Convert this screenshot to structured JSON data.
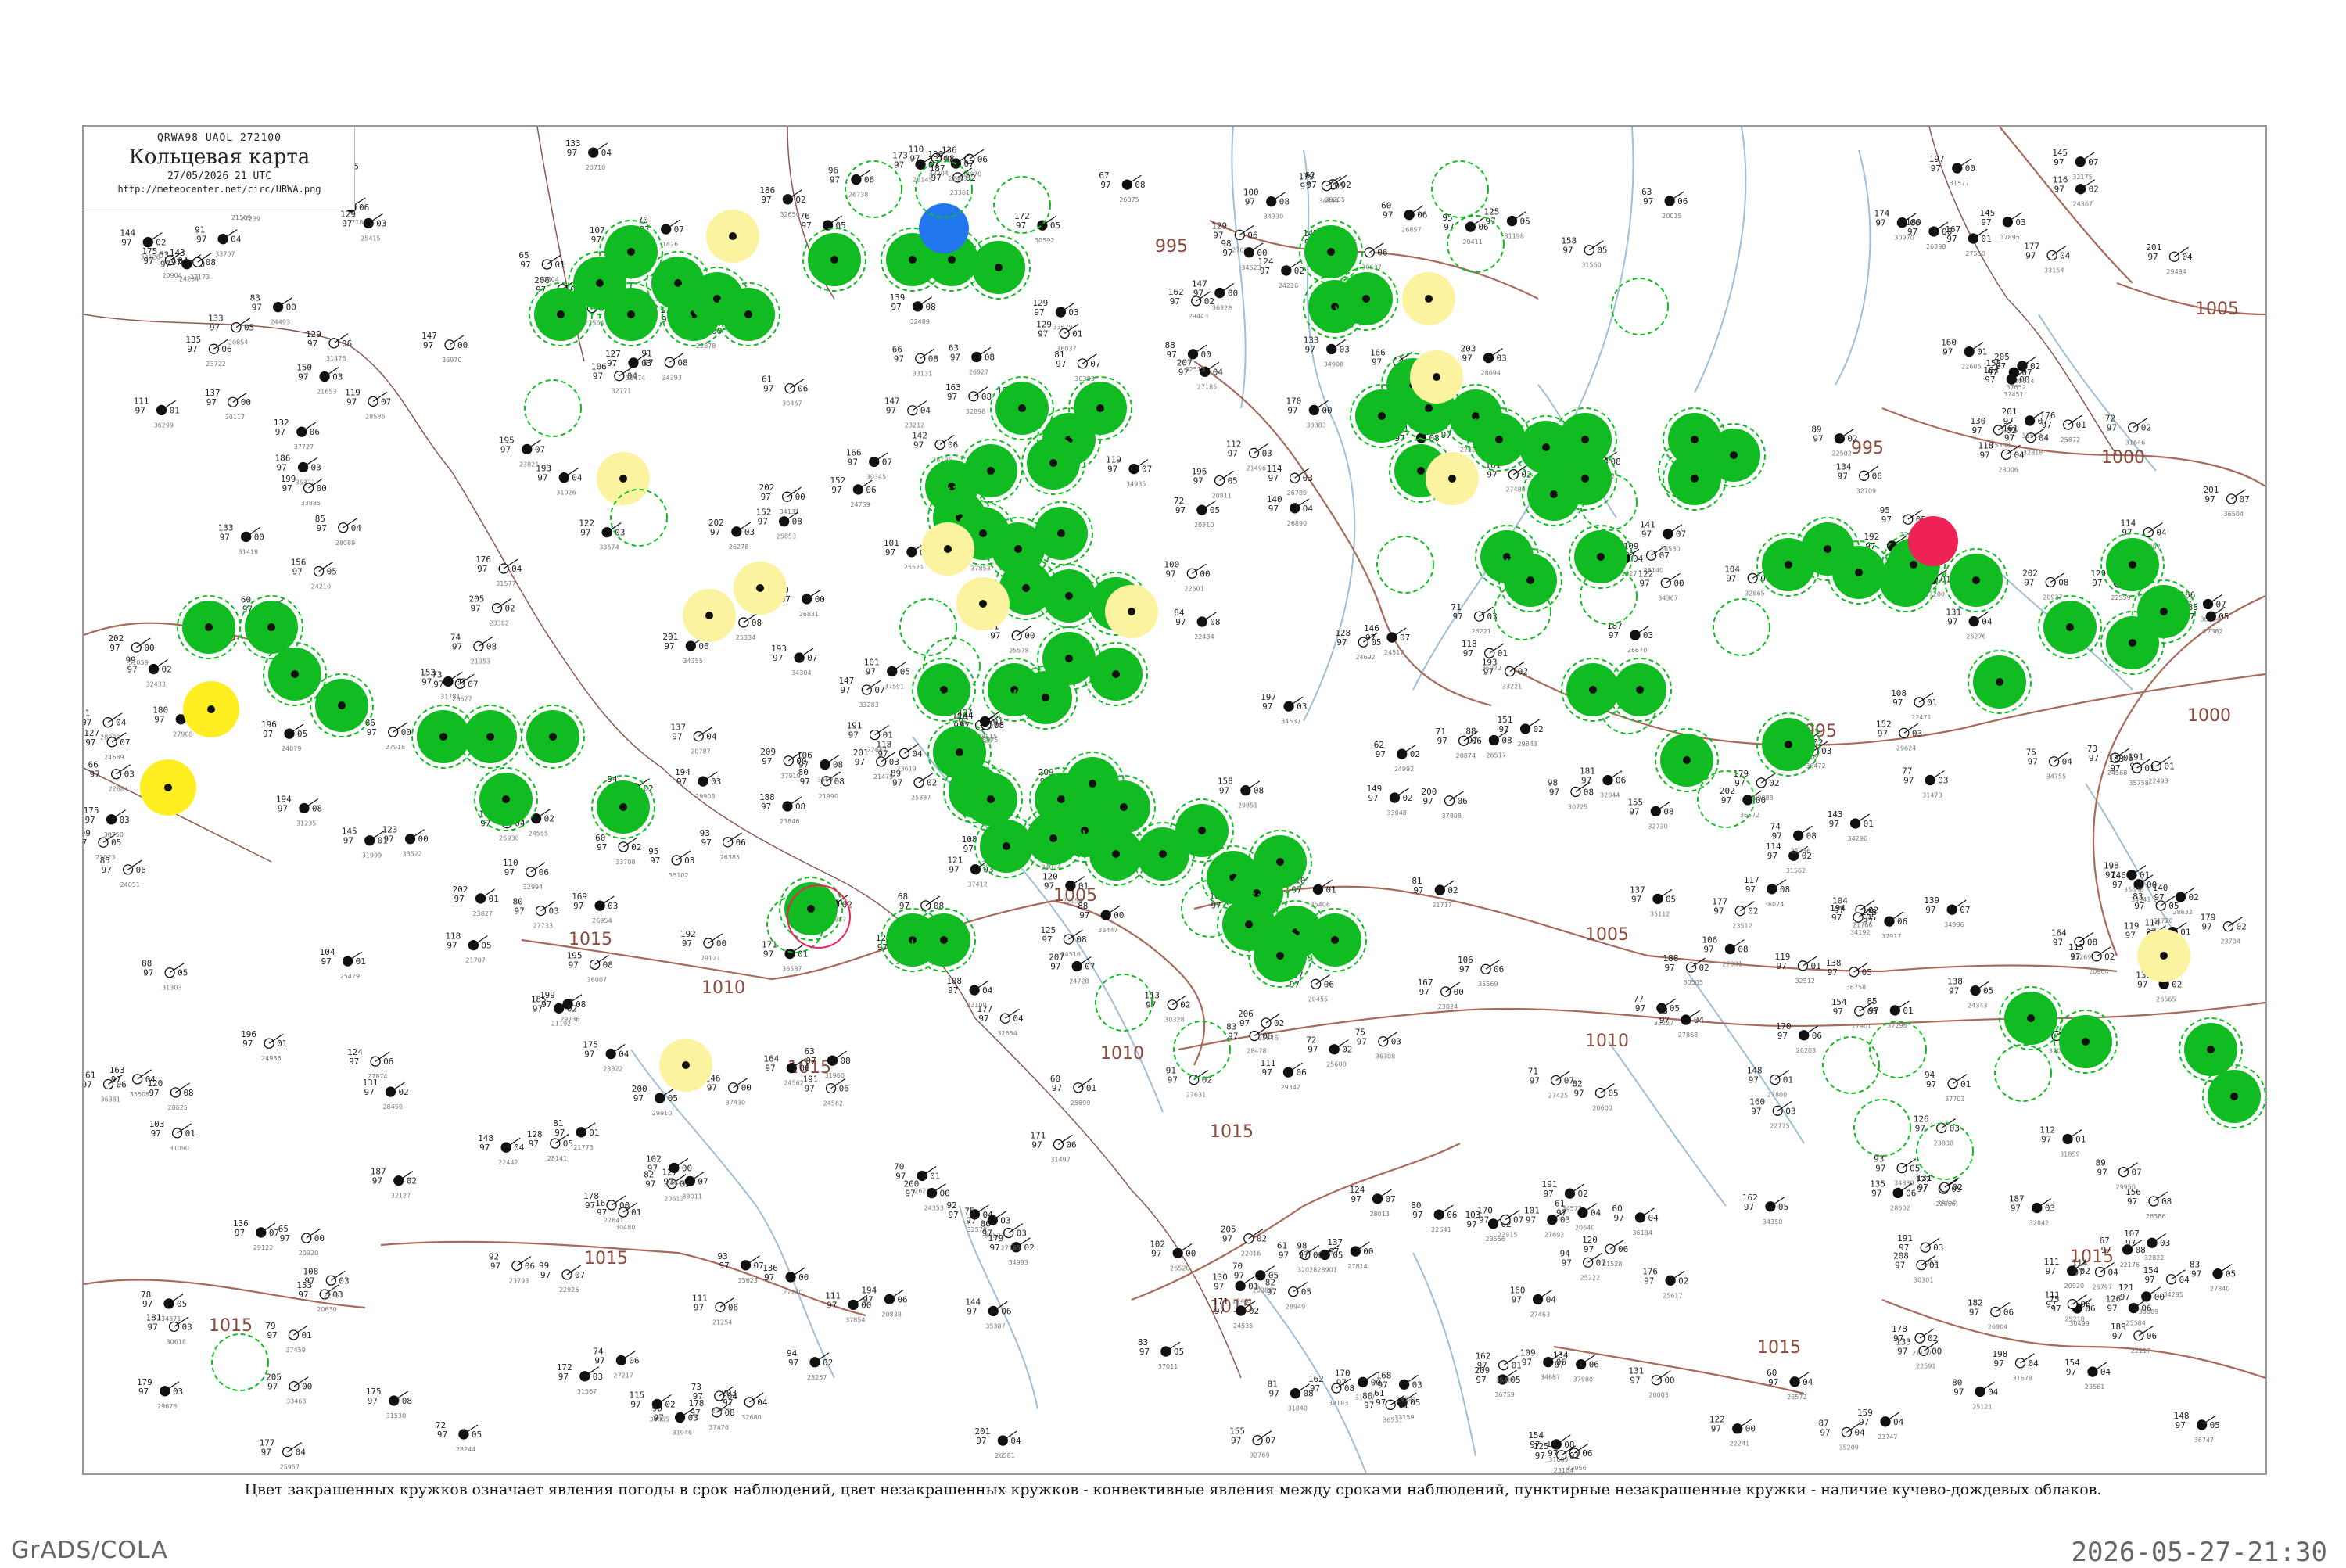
{
  "header": {
    "code": "QRWA98  UAOL  272100",
    "title": "Кольцевая карта",
    "date": "27/05/2026 21 UTC",
    "url": "http://meteocenter.net/circ/URWA.png"
  },
  "caption": "Цвет закрашенных кружков означает явления погоды в срок наблюдений, цвет незакрашенных кружков - конвективные явления между сроками наблюдений, пунктирные незакрашенные кружки - наличие кучево-дождевых облаков.",
  "footer": {
    "left": "GrADS/COLA",
    "right": "2026-05-27-21:30"
  },
  "colors": {
    "green": "#11bb22",
    "yellow": "#ffee22",
    "blue": "#2277ee",
    "red": "#ee2255",
    "pale_yellow": "#fbf3a0",
    "isobar": "#a86a5a",
    "river": "#9fbfd6"
  },
  "isobar_labels": [
    "1015",
    "1015",
    "1010",
    "1015",
    "1015",
    "1015",
    "1015",
    "1010",
    "1005",
    "1005",
    "1000",
    "1000",
    "995",
    "995",
    "995",
    "1005",
    "1015",
    "1010",
    "1015",
    "1015"
  ],
  "stations": {
    "filled_green": [
      {
        "id": "Ф1",
        "label": "98"
      },
      {
        "id": "Ф2",
        "label": "99"
      },
      {
        "id": "Ф3",
        "label": "97"
      }
    ],
    "filled_yellow": [
      {
        "label": "91"
      },
      {
        "label": "93"
      },
      {
        "label": "150"
      },
      {
        "label": "181"
      }
    ],
    "filled_blue": [
      {
        "label": "86"
      }
    ],
    "filled_red": [
      {
        "label": "142"
      }
    ],
    "pale_yellow_labels": [
      "117",
      "126",
      "130",
      "90",
      "62",
      "67",
      "06",
      "003",
      "045"
    ]
  },
  "sample_numbers": [
    "1015",
    "1010",
    "1005",
    "1000",
    "995"
  ]
}
